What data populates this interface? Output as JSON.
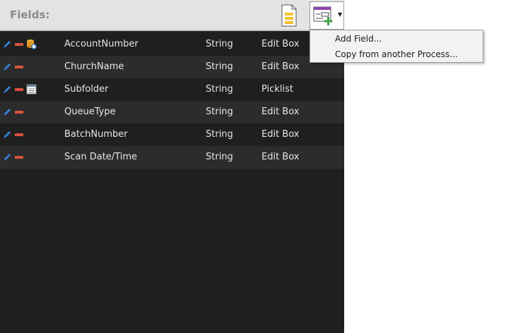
{
  "header": {
    "title": "Fields:"
  },
  "fields": [
    {
      "name": "AccountNumber",
      "type": "String",
      "control": "Edit Box",
      "extra_icon": "database-lookup-icon"
    },
    {
      "name": "ChurchName",
      "type": "String",
      "control": "Edit Box",
      "extra_icon": ""
    },
    {
      "name": "Subfolder",
      "type": "String",
      "control": "Picklist",
      "extra_icon": "picklist-icon"
    },
    {
      "name": "QueueType",
      "type": "String",
      "control": "Edit Box",
      "extra_icon": ""
    },
    {
      "name": "BatchNumber",
      "type": "String",
      "control": "Edit Box",
      "extra_icon": ""
    },
    {
      "name": "Scan Date/Time",
      "type": "String",
      "control": "Edit Box",
      "extra_icon": ""
    }
  ],
  "menu": {
    "items": [
      "Add Field...",
      "Copy from another Process..."
    ]
  },
  "colors": {
    "panel_bg": "#1f1f1f",
    "row_alt_bg": "#2c2c2c",
    "header_bg": "#e3e3e3",
    "remove_red": "#d8533a",
    "edit_blue": "#3b7fd6",
    "add_green": "#3fa34d",
    "accent_purple": "#8e44ad"
  }
}
